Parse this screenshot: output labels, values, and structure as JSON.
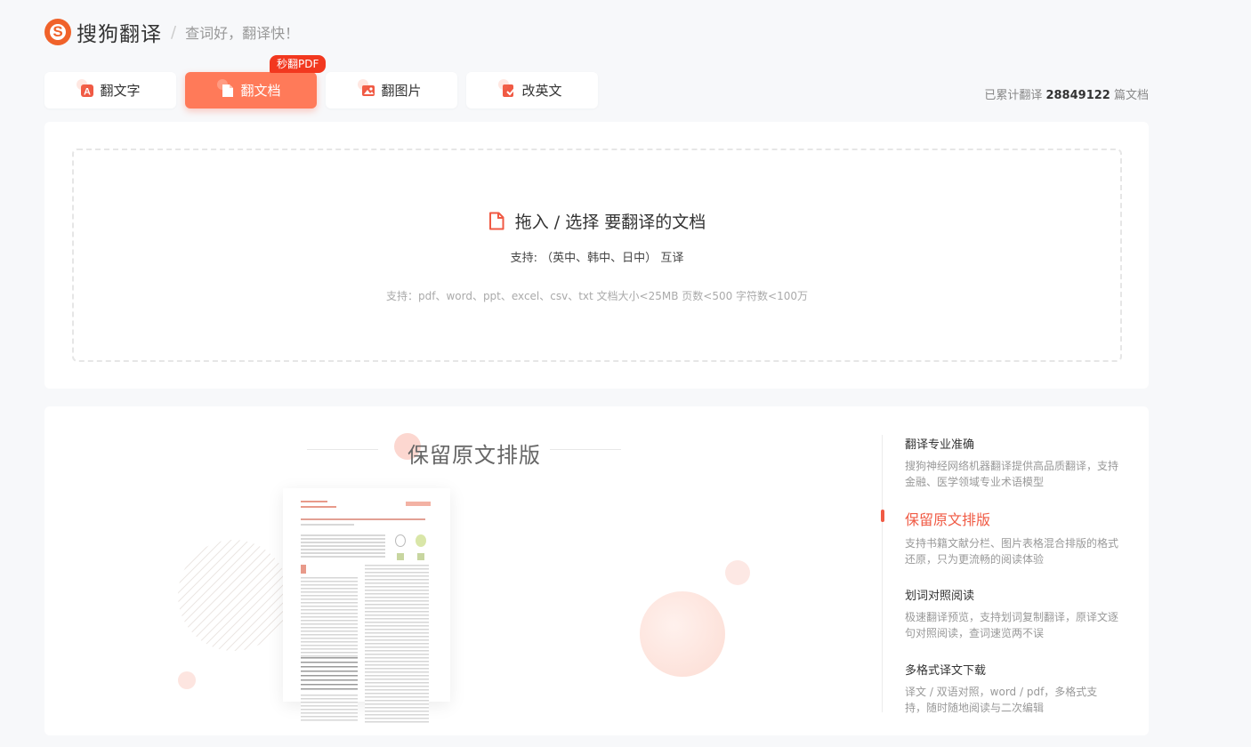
{
  "header": {
    "brand": "搜狗翻译",
    "separator": "/",
    "slogan": "查词好，翻译快！"
  },
  "tabs": [
    {
      "label": "翻文字",
      "icon": "text-translate-icon",
      "active": false
    },
    {
      "label": "翻文档",
      "icon": "document-icon",
      "active": true,
      "badge": "秒翻PDF"
    },
    {
      "label": "翻图片",
      "icon": "image-icon",
      "active": false
    },
    {
      "label": "改英文",
      "icon": "correct-english-icon",
      "active": false
    }
  ],
  "counter": {
    "prefix": "已累计翻译",
    "count": "28849122",
    "suffix": "篇文档"
  },
  "upload": {
    "title": "拖入 / 选择 要翻译的文档",
    "languages": "支持: （英中、韩中、日中） 互译",
    "hint": "支持：pdf、word、ppt、excel、csv、txt    文档大小<25MB 页数<500 字符数<100万"
  },
  "feature": {
    "heading": "保留原文排版",
    "items": [
      {
        "title": "翻译专业准确",
        "desc": "搜狗神经网络机器翻译提供高品质翻译，支持金融、医学领域专业术语模型"
      },
      {
        "title": "保留原文排版",
        "desc": "支持书籍文献分栏、图片表格混合排版的格式还原，只为更流畅的阅读体验"
      },
      {
        "title": "划词对照阅读",
        "desc": "极速翻译预览，支持划词复制翻译，原译文逐句对照阅读，查词速览两不误"
      },
      {
        "title": "多格式译文下载",
        "desc": "译文 / 双语对照，word / pdf，多格式支持，随时随地阅读与二次编辑"
      }
    ]
  },
  "colors": {
    "accent": "#ff7a59",
    "badge": "#f2381f",
    "brand": "#f0622a"
  }
}
